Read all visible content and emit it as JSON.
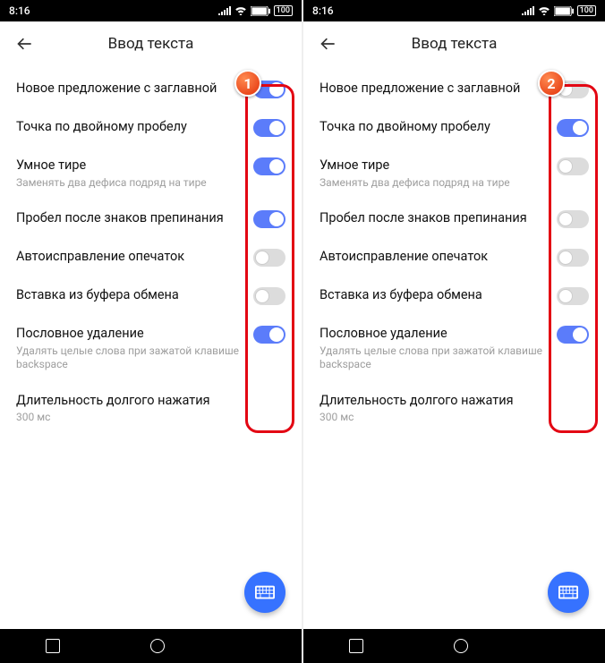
{
  "status": {
    "time": "8:16",
    "battery": "100"
  },
  "appbar": {
    "title": "Ввод текста"
  },
  "rows": [
    {
      "title": "Новое предложение с заглавной",
      "sub": ""
    },
    {
      "title": "Точка по двойному пробелу",
      "sub": ""
    },
    {
      "title": "Умное тире",
      "sub": "Заменять два дефиса подряд на тире"
    },
    {
      "title": "Пробел после знаков препинания",
      "sub": ""
    },
    {
      "title": "Автоисправление опечаток",
      "sub": ""
    },
    {
      "title": "Вставка из буфера обмена",
      "sub": ""
    },
    {
      "title": "Пословное удаление",
      "sub": "Удалять целые слова при зажатой клавише backspace"
    },
    {
      "title": "Длительность долгого нажатия",
      "sub": "300 мс"
    }
  ],
  "panels": [
    {
      "callout": "1",
      "states": [
        true,
        true,
        true,
        true,
        false,
        false,
        true,
        null
      ]
    },
    {
      "callout": "2",
      "states": [
        false,
        true,
        false,
        false,
        false,
        false,
        true,
        null
      ]
    }
  ]
}
